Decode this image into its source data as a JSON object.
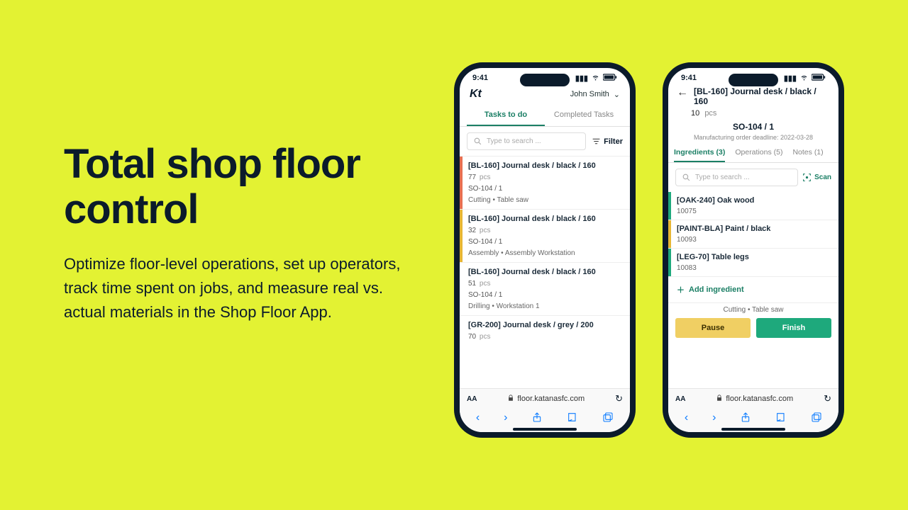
{
  "marketing": {
    "headline": "Total shop floor control",
    "body": "Optimize floor-level operations, set up operators, track time spent on jobs, and measure real vs. actual materials in the Shop Floor App."
  },
  "status": {
    "time": "9:41"
  },
  "browser": {
    "url": "floor.katanasfc.com",
    "aa": "AA"
  },
  "phone1": {
    "logo": "Kt",
    "user": "John Smith",
    "tabs": {
      "todo": "Tasks to do",
      "done": "Completed Tasks"
    },
    "search": {
      "placeholder": "Type to search ...",
      "filter": "Filter"
    },
    "tasks": [
      {
        "title": "[BL-160] Journal desk / black / 160",
        "qty": "77",
        "unit": "pcs",
        "so": "SO-104 / 1",
        "op": "Cutting  •  Table saw",
        "accent": "#e76f51"
      },
      {
        "title": "[BL-160] Journal desk / black / 160",
        "qty": "32",
        "unit": "pcs",
        "so": "SO-104 / 1",
        "op": "Assembly  •  Assembly Workstation",
        "accent": "#e7b634"
      },
      {
        "title": "[BL-160] Journal desk / black / 160",
        "qty": "51",
        "unit": "pcs",
        "so": "SO-104 / 1",
        "op": "Drilling  •  Workstation 1",
        "accent": "#ffffff"
      },
      {
        "title": "[GR-200] Journal desk / grey / 200",
        "qty": "70",
        "unit": "pcs",
        "so": "",
        "op": "",
        "accent": "#ffffff"
      }
    ]
  },
  "phone2": {
    "title": "[BL-160] Journal desk / black / 160",
    "qty": "10",
    "unit": "pcs",
    "so": "SO-104 / 1",
    "deadline": "Manufacturing order deadline: 2022-03-28",
    "tabs": {
      "ing": "Ingredients (3)",
      "ops": "Operations (5)",
      "notes": "Notes (1)"
    },
    "search": {
      "placeholder": "Type to search ...",
      "scan": "Scan"
    },
    "ingredients": [
      {
        "name": "[OAK-240] Oak wood",
        "code": "10075",
        "color": "green"
      },
      {
        "name": "[PAINT-BLA] Paint / black",
        "code": "10093",
        "color": "yellow"
      },
      {
        "name": "[LEG-70] Table legs",
        "code": "10083",
        "color": "green"
      }
    ],
    "add": "Add ingredient",
    "op_line": "Cutting  •  Table saw",
    "buttons": {
      "pause": "Pause",
      "finish": "Finish"
    }
  }
}
